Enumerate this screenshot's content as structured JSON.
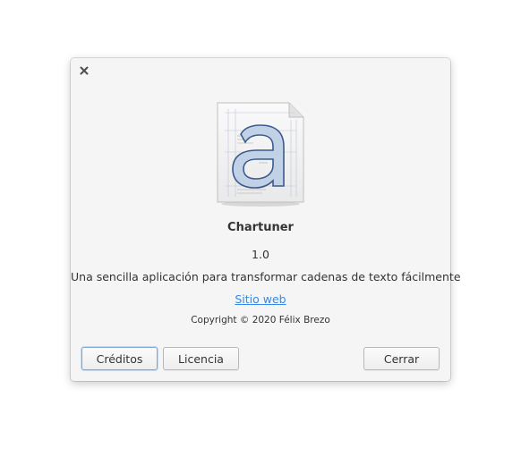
{
  "dialog": {
    "close_icon": "close-icon",
    "app_icon": "chartuner-icon",
    "name": "Chartuner",
    "version": "1.0",
    "description": "Una sencilla aplicación para transformar cadenas de texto fácilmente",
    "website_label": "Sitio web",
    "copyright": "Copyright © 2020 Félix Brezo",
    "buttons": {
      "credits": "Créditos",
      "license": "Licencia",
      "close": "Cerrar"
    }
  },
  "colors": {
    "dialog_bg": "#f5f5f5",
    "link": "#3689e6",
    "text": "#333333",
    "icon_letter_fill": "#c2d2e6",
    "icon_letter_stroke": "#3c5a8c"
  }
}
